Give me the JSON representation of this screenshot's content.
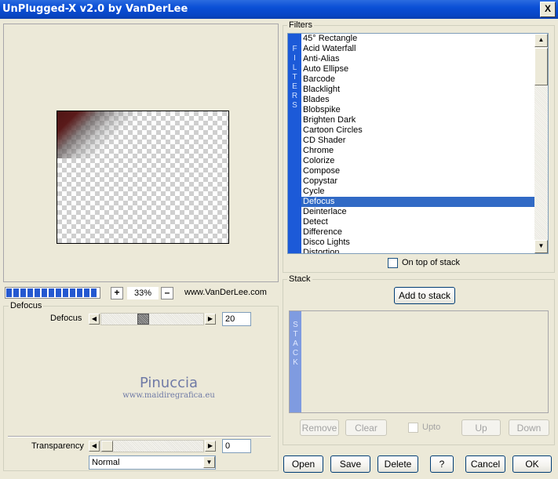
{
  "window": {
    "title": "UnPlugged-X v2.0 by VanDerLee",
    "close_label": "X"
  },
  "filters": {
    "group_label": "Filters",
    "strip_letters": [
      "F",
      "I",
      "L",
      "T",
      "E",
      "R",
      "S"
    ],
    "items": [
      "45° Rectangle",
      "Acid Waterfall",
      "Anti-Alias",
      "Auto Ellipse",
      "Barcode",
      "Blacklight",
      "Blades",
      "Blobspike",
      "Brighten Dark",
      "Cartoon Circles",
      "CD Shader",
      "Chrome",
      "Colorize",
      "Compose",
      "Copystar",
      "Cycle",
      "Defocus",
      "Deinterlace",
      "Detect",
      "Difference",
      "Disco Lights",
      "Distortion"
    ],
    "selected": "Defocus",
    "on_top_label": "On top of stack",
    "on_top_checked": false
  },
  "zoom": {
    "value": "33%",
    "plus_label": "+",
    "minus_label": "–",
    "website": "www.VanDerLee.com",
    "progress_segments": 13
  },
  "effect": {
    "group_label": "Defocus",
    "param_label": "Defocus",
    "param_value": "20",
    "param_fraction": 0.4,
    "watermark": "Pinuccia",
    "watermark_sub": "www.maidiregrafica.eu"
  },
  "transparency": {
    "label": "Transparency",
    "value": "0",
    "fraction": 0.0,
    "blend_mode": "Normal"
  },
  "stack": {
    "group_label": "Stack",
    "add_label": "Add to stack",
    "strip_letters": [
      "S",
      "T",
      "A",
      "C",
      "K"
    ],
    "remove_label": "Remove",
    "clear_label": "Clear",
    "upto_label": "Upto",
    "up_label": "Up",
    "down_label": "Down"
  },
  "footer": {
    "open_label": "Open",
    "save_label": "Save",
    "delete_label": "Delete",
    "help_label": "?",
    "cancel_label": "Cancel",
    "ok_label": "OK"
  }
}
